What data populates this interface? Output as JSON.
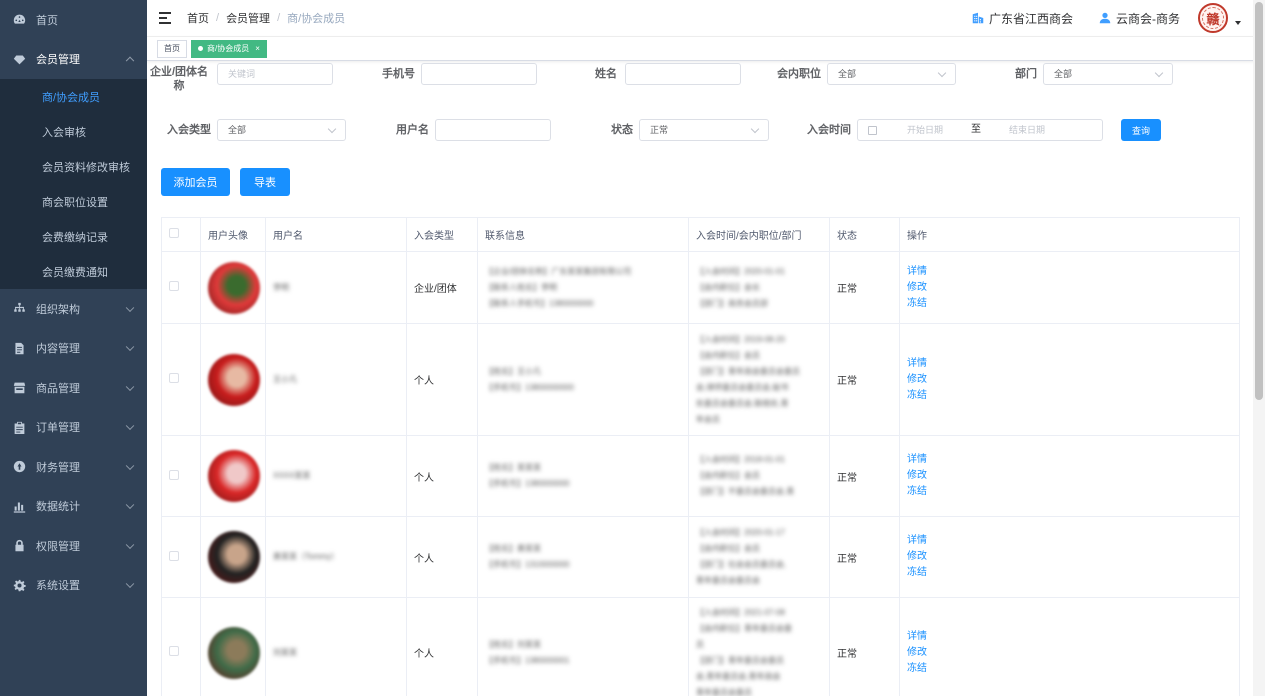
{
  "sidebar": {
    "items": [
      {
        "label": "首页",
        "icon": "dashboard-icon"
      },
      {
        "label": "会员管理",
        "icon": "gem-icon",
        "expanded": true,
        "children": [
          "商/协会成员",
          "入会审核",
          "会员资料修改审核",
          "商会职位设置",
          "会费缴纳记录",
          "会员缴费通知"
        ],
        "active_child": "商/协会成员"
      },
      {
        "label": "组织架构",
        "icon": "tree-icon"
      },
      {
        "label": "内容管理",
        "icon": "document-icon"
      },
      {
        "label": "商品管理",
        "icon": "shop-icon"
      },
      {
        "label": "订单管理",
        "icon": "clipboard-icon"
      },
      {
        "label": "财务管理",
        "icon": "coin-icon"
      },
      {
        "label": "数据统计",
        "icon": "bar-chart-icon"
      },
      {
        "label": "权限管理",
        "icon": "lock-icon"
      },
      {
        "label": "系统设置",
        "icon": "gear-icon"
      }
    ]
  },
  "navbar": {
    "breadcrumb": [
      "首页",
      "会员管理",
      "商/协会成员"
    ],
    "org_name": "广东省江西商会",
    "user_name": "云商会-商务",
    "seal_char": "赣"
  },
  "tags": [
    {
      "label": "首页",
      "active": false
    },
    {
      "label": "商/协会成员",
      "active": true,
      "close": "×"
    }
  ],
  "filters": {
    "company_label_line1": "企业/团体名",
    "company_label_line2": "称",
    "company_placeholder": "关键词",
    "phone_label": "手机号",
    "name_label": "姓名",
    "position_label": "会内职位",
    "position_value": "全部",
    "dept_label": "部门",
    "dept_value": "全部",
    "join_type_label": "入会类型",
    "join_type_value": "全部",
    "username_label": "用户名",
    "status_label": "状态",
    "status_value": "正常",
    "join_time_label": "入会时间",
    "start_placeholder": "开始日期",
    "to_label": "至",
    "end_placeholder": "结束日期",
    "query_button": "查询"
  },
  "actions": {
    "add_member": "添加会员",
    "export": "导表"
  },
  "table": {
    "headers": [
      "用户头像",
      "用户名",
      "入会类型",
      "联系信息",
      "入会时间/会内职位/部门",
      "状态",
      "操作"
    ],
    "ops": [
      "详情",
      "修改",
      "冻结"
    ],
    "rows": [
      {
        "username": "李明",
        "join_type": "企业/团体",
        "contact": [
          "【企业/团体名称】广东某某集团有限公司",
          "【联系人姓名】李明",
          "【联系人手机号】1380000000"
        ],
        "join_info": [
          "【入会时间】2020-01-01",
          "【会内职位】会长",
          "【部门】商务会员部"
        ],
        "status": "正常",
        "avatar_colors": [
          "#e03a3a",
          "#3a6b2e"
        ]
      },
      {
        "username": "王小凡",
        "join_type": "个人",
        "contact": [
          "【姓名】王小凡",
          "【手机号】13800000000"
        ],
        "join_info": [
          "【入会时间】2019-08-20",
          "【会内职位】会员",
          "【部门】青年商会委员会委员",
          "会,律师委员会委员会,秘书",
          "处委员会委员会,联络处,青",
          "年会员"
        ],
        "status": "正常",
        "avatar_colors": [
          "#c81d1d",
          "#e7b9a3"
        ]
      },
      {
        "username": "XXXX某某",
        "join_type": "个人",
        "contact": [
          "【姓名】某某某",
          "【手机号】1380000000"
        ],
        "join_info": [
          "【入会时间】2018-01-01",
          "【会内职位】会员",
          "【部门】不委员会委员会,青"
        ],
        "status": "正常",
        "avatar_colors": [
          "#d92727",
          "#f0c8c8"
        ]
      },
      {
        "username": "黄某某（Tommy）",
        "join_type": "个人",
        "contact": [
          "【姓名】黄某某",
          "【手机号】1310000000"
        ],
        "join_info": [
          "【入会时间】2020-01-17",
          "【会内职位】会员",
          "【部门】社会会员委员会,",
          "青年委员会委员会"
        ],
        "status": "正常",
        "avatar_colors": [
          "#222222",
          "#c8a48a"
        ]
      },
      {
        "username": "刘某某",
        "join_type": "个人",
        "contact": [
          "【姓名】刘某某",
          "【手机号】1380000001"
        ],
        "join_info": [
          "【入会时间】2021-07-08",
          "【会内职位】青年委员会委",
          "员",
          "【部门】青年委员会委员",
          "会,青年委员会,青年商会",
          "青年委员会委员"
        ],
        "status": "正常",
        "avatar_colors": [
          "#3f6b48",
          "#8c7b5a"
        ]
      }
    ]
  }
}
